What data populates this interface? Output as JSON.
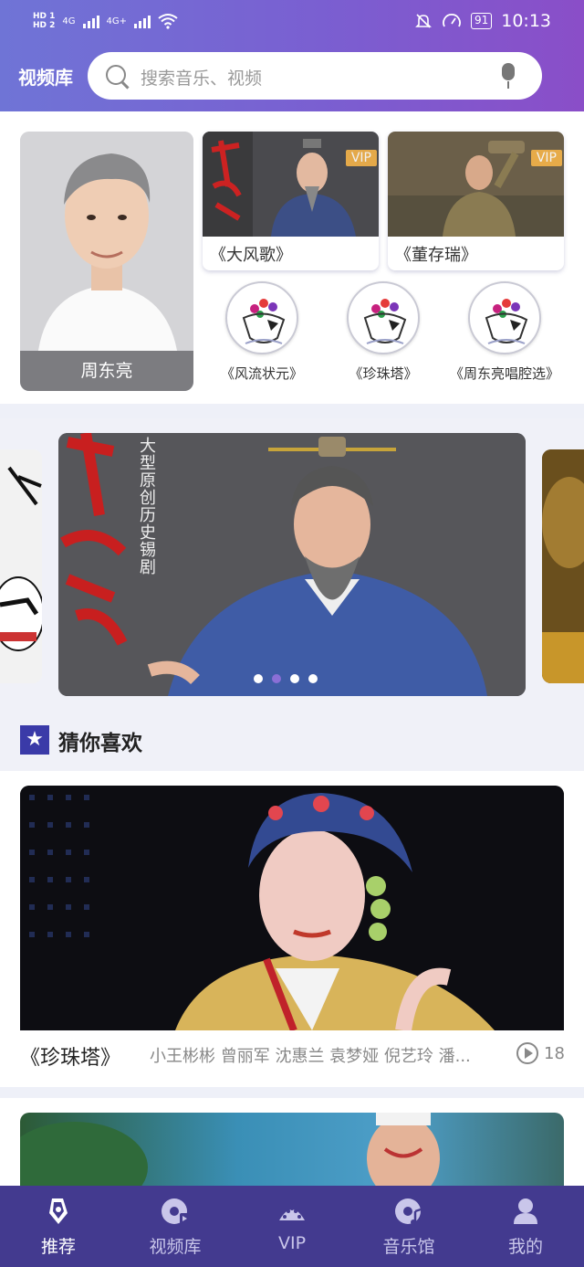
{
  "status_bar": {
    "sim1": "HD 1",
    "sim2": "HD 2",
    "net1": "4G",
    "net2": "4G+",
    "battery": "91",
    "time": "10:13"
  },
  "header": {
    "title": "视频库",
    "search_placeholder": "搜索音乐、视频"
  },
  "featured": {
    "artist_name": "周东亮",
    "videos": [
      {
        "title": "《大风歌》",
        "badge": "VIP"
      },
      {
        "title": "《董存瑞》",
        "badge": "VIP"
      }
    ],
    "albums": [
      {
        "title": "《风流状元》"
      },
      {
        "title": "《珍珠塔》"
      },
      {
        "title": "《周东亮唱腔选》"
      }
    ]
  },
  "banner": {
    "vertical_text": "大型原创历史锡剧",
    "dots": 4,
    "active_dot": 1
  },
  "recommend": {
    "heading": "猜你喜欢",
    "items": [
      {
        "title": "《珍珠塔》",
        "cast": "小王彬彬 曾丽军 沈惠兰 袁梦娅 倪艺玲 潘...",
        "plays": "18"
      }
    ]
  },
  "bottom_nav": {
    "items": [
      {
        "label": "推荐",
        "icon": "recommend-icon",
        "active": true
      },
      {
        "label": "视频库",
        "icon": "video-disc-icon",
        "active": false
      },
      {
        "label": "VIP",
        "icon": "vip-crown-icon",
        "active": false
      },
      {
        "label": "音乐馆",
        "icon": "music-disc-icon",
        "active": false
      },
      {
        "label": "我的",
        "icon": "user-icon",
        "active": false
      }
    ]
  },
  "colors": {
    "header_gradient_start": "#6f74d6",
    "header_gradient_end": "#8a4ec8",
    "nav_background": "#433a8f",
    "vip_badge": "#f2b24a"
  }
}
